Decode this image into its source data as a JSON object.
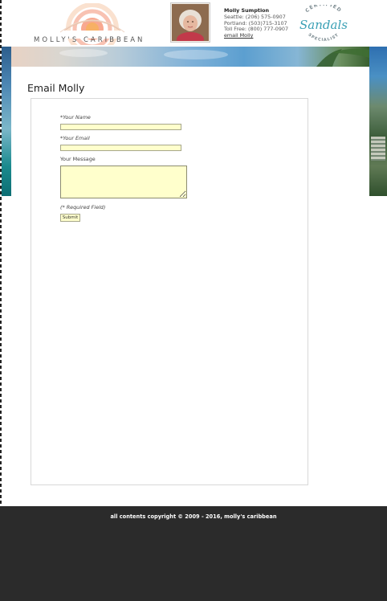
{
  "header": {
    "logo_text": "MOLLY'S CARIBBEAN",
    "contact": {
      "name": "Molly Sumption",
      "seattle": "Seattle: (206) 575-0907",
      "portland": "Portland: (503)715-3107",
      "toll_free": "Toll Free: (800) 777-0907",
      "email_link": "email Molly"
    },
    "sandals_logo": {
      "brand": "Sandals",
      "arc_top": "CERTIFIED",
      "arc_bottom": "SPECIALIST"
    }
  },
  "main": {
    "title": "Email Molly",
    "form": {
      "name_label": "*Your Name",
      "name_value": "",
      "email_label": "*Your Email",
      "email_value": "",
      "message_label": "Your Message",
      "message_value": "",
      "required_note": "(* Required Field)",
      "submit_label": "Submit"
    }
  },
  "footer": {
    "copyright": "all contents copyright © 2009 - 2016, molly's caribbean"
  },
  "colors": {
    "field_bg": "#ffffcc",
    "footer_bg": "#2b2b2b",
    "sandals_teal": "#3aa0b5"
  },
  "icons": [
    "sunrise-logo-icon",
    "resize-grip-icon"
  ]
}
